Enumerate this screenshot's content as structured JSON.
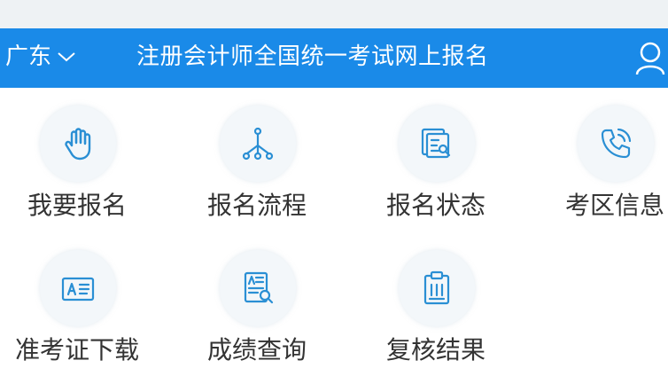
{
  "header": {
    "region": "广东",
    "title": "注册会计师全国统一考试网上报名"
  },
  "menu": {
    "items": [
      {
        "label": "我要报名",
        "icon": "hand-icon"
      },
      {
        "label": "报名流程",
        "icon": "flow-icon"
      },
      {
        "label": "报名状态",
        "icon": "status-doc-icon"
      },
      {
        "label": "考区信息",
        "icon": "phone-icon"
      },
      {
        "label": "准考证下载",
        "icon": "id-card-icon"
      },
      {
        "label": "成绩查询",
        "icon": "score-search-icon"
      },
      {
        "label": "复核结果",
        "icon": "clipboard-icon"
      }
    ]
  },
  "colors": {
    "header_bg": "#1a8ae8",
    "icon": "#2a8fd4"
  }
}
